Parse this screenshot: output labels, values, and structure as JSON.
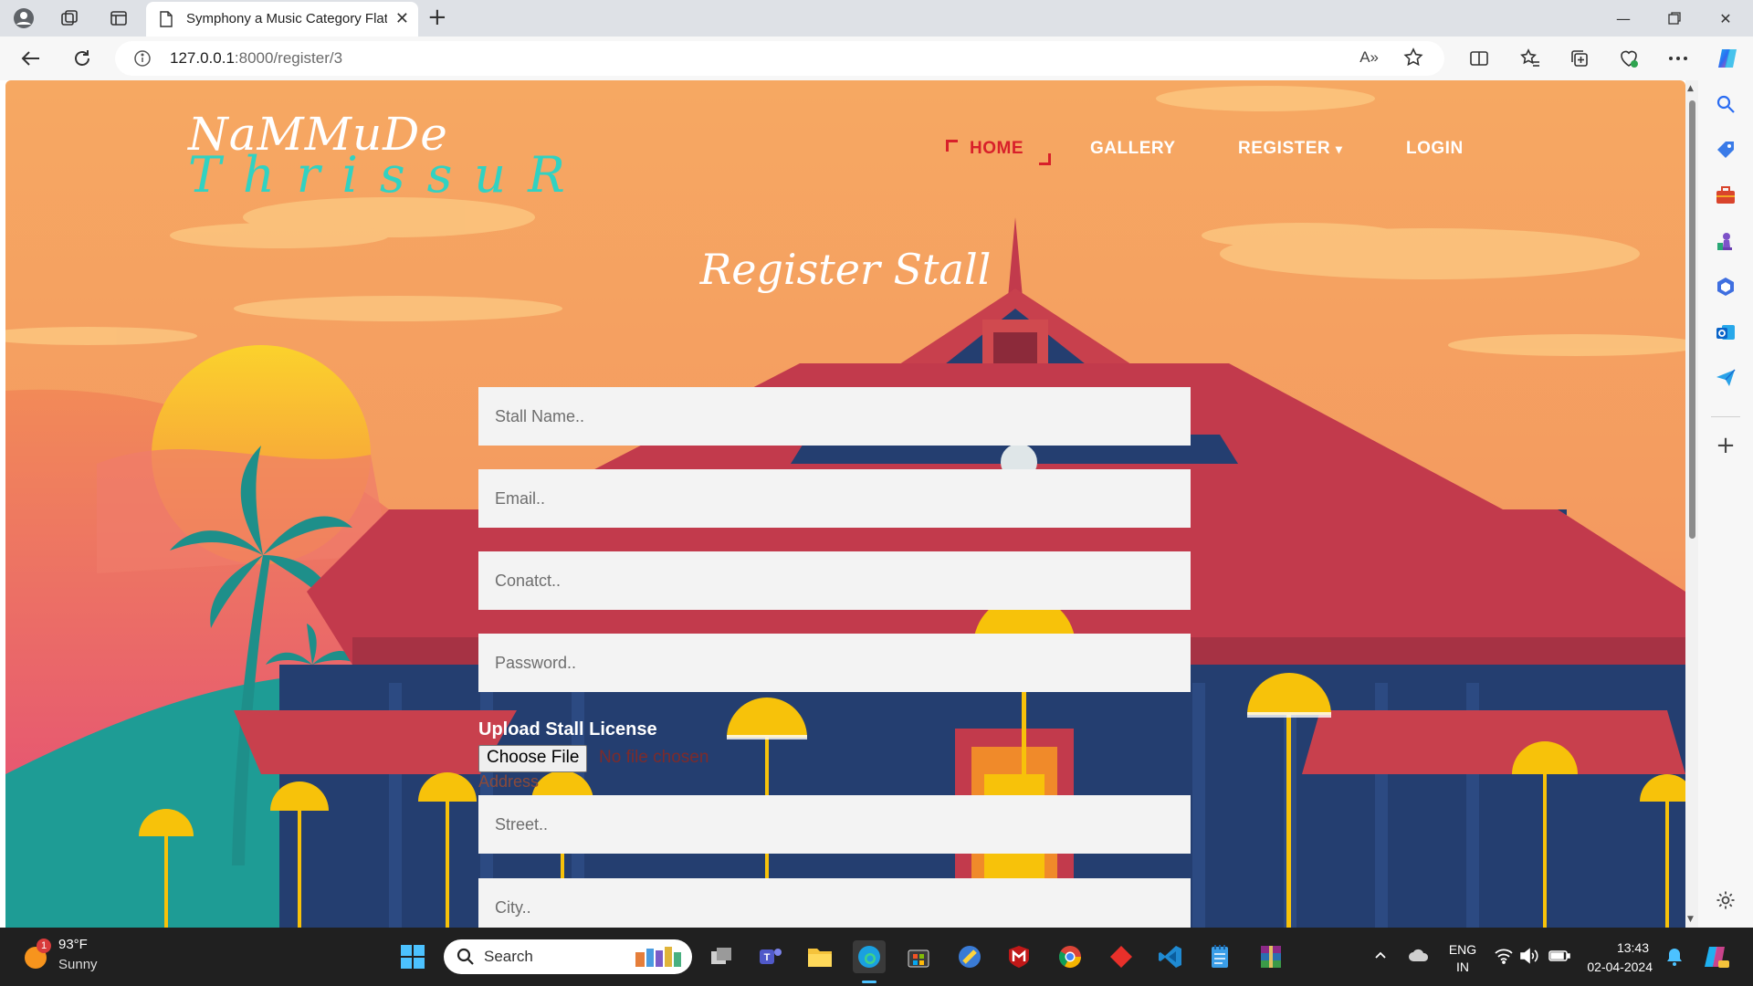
{
  "browser": {
    "tab_title": "Symphony a Music Category Flat",
    "url_host": "127.0.0.1",
    "url_path": ":8000/register/3",
    "read_aloud": "A»"
  },
  "site": {
    "logo_line1": "NaMMuDe",
    "logo_line2": "ThrissuR",
    "nav": {
      "home": "HOME",
      "gallery": "GALLERY",
      "register": "REGISTER",
      "register_caret": "▾",
      "login": "LOGIN"
    },
    "page_title": "Register Stall",
    "form": {
      "stall_name_placeholder": "Stall Name..",
      "email_placeholder": "Email..",
      "contact_placeholder": "Conatct..",
      "password_placeholder": "Password..",
      "upload_label": "Upload Stall License",
      "choose_file": "Choose File",
      "file_status": "No file chosen",
      "address_label": "Address",
      "street_placeholder": "Street..",
      "city_placeholder": "City.."
    }
  },
  "taskbar": {
    "weather_temp": "93°F",
    "weather_desc": "Sunny",
    "weather_badge": "1",
    "search_label": "Search",
    "lang_line1": "ENG",
    "lang_line2": "IN",
    "time": "13:43",
    "date": "02-04-2024"
  },
  "colors": {
    "sky_top": "#f6a862",
    "sky_bottom": "#f07c56",
    "roof": "#c23a4c",
    "temple_body": "#243e70",
    "teal": "#1e9c95",
    "umbrella": "#f7c20a",
    "nav_active": "#d8202a",
    "logo_accent": "#31d2c2"
  }
}
